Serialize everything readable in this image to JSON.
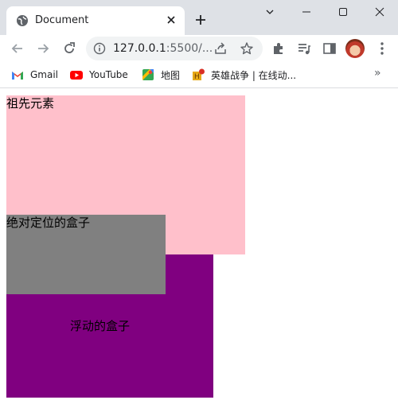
{
  "tab": {
    "title": "Document"
  },
  "window_controls": {
    "chevron": "chevron-down-icon",
    "minimize": "minimize-icon",
    "maximize": "maximize-icon",
    "close": "close-icon"
  },
  "address_bar": {
    "host": "127.0.0.1",
    "rest": ":5500/..."
  },
  "bookmarks": [
    {
      "label": "Gmail",
      "icon": "gmail-icon"
    },
    {
      "label": "YouTube",
      "icon": "youtube-icon"
    },
    {
      "label": "地图",
      "icon": "maps-icon"
    },
    {
      "label": "英雄战争 | 在线动...",
      "icon": "game-icon"
    }
  ],
  "bookmarks_more": "»",
  "page": {
    "ancestor_label": "祖先元素",
    "absolute_label": "绝对定位的盒子",
    "float_label": "浮动的盒子"
  },
  "colors": {
    "ancestor": "pink",
    "absolute": "grey",
    "float": "purple",
    "tabstrip": "#dee1e6"
  }
}
